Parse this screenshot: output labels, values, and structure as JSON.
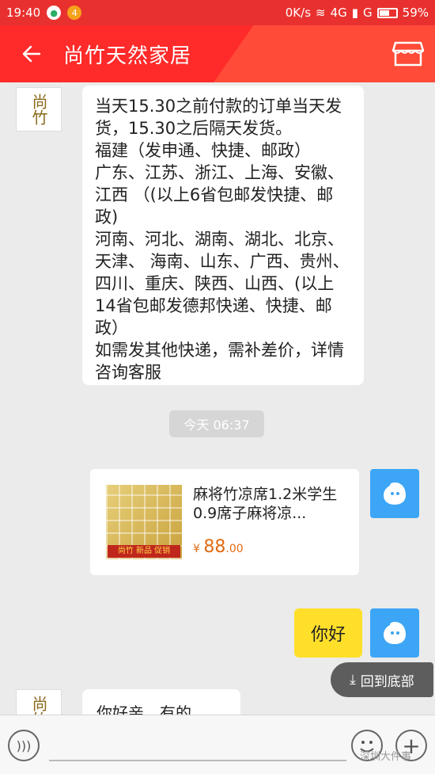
{
  "status_bar": {
    "time": "19:40",
    "notification_count": "4",
    "network_speed": "0K/s",
    "network_type": "4G",
    "signal_label": "G",
    "battery": "59%"
  },
  "header": {
    "title": "尚竹天然家居",
    "back_icon": "arrow-left-icon",
    "store_icon": "store-icon"
  },
  "shop_avatar_text": "尚竹",
  "messages": {
    "shop_notice": [
      "当天15.30之前付款的订单当天发货，15.30之后隔天发货。",
      "福建（发申通、快捷、邮政）",
      "广东、江苏、浙江、上海、安徽、江西 （(以上6省包邮发快捷、邮政)",
      "河南、河北、湖南、湖北、北京、天津、 海南、山东、广西、贵州、四川、重庆、陕西、山西、(以上14省包邮发德邦快递、快捷、邮政）",
      "如需发其他快递，需补差价，详情咨询客服"
    ],
    "timestamp": "今天 06:37",
    "product": {
      "title": "麻将竹凉席1.2米学生0.9席子麻将凉...",
      "currency": "¥",
      "price_int": "88",
      "price_dec": ".00",
      "image_tag": "尚竹 新品 促销"
    },
    "hello": "你好",
    "partial_reply": "你好亲，有的"
  },
  "back_to_bottom": "回到底部",
  "watermark": "深圳大件事",
  "colors": {
    "header_red": "#ff2a2a",
    "bubble_yellow": "#ffdf2a",
    "price_orange": "#e26b14",
    "avatar_blue": "#3da5f5"
  }
}
